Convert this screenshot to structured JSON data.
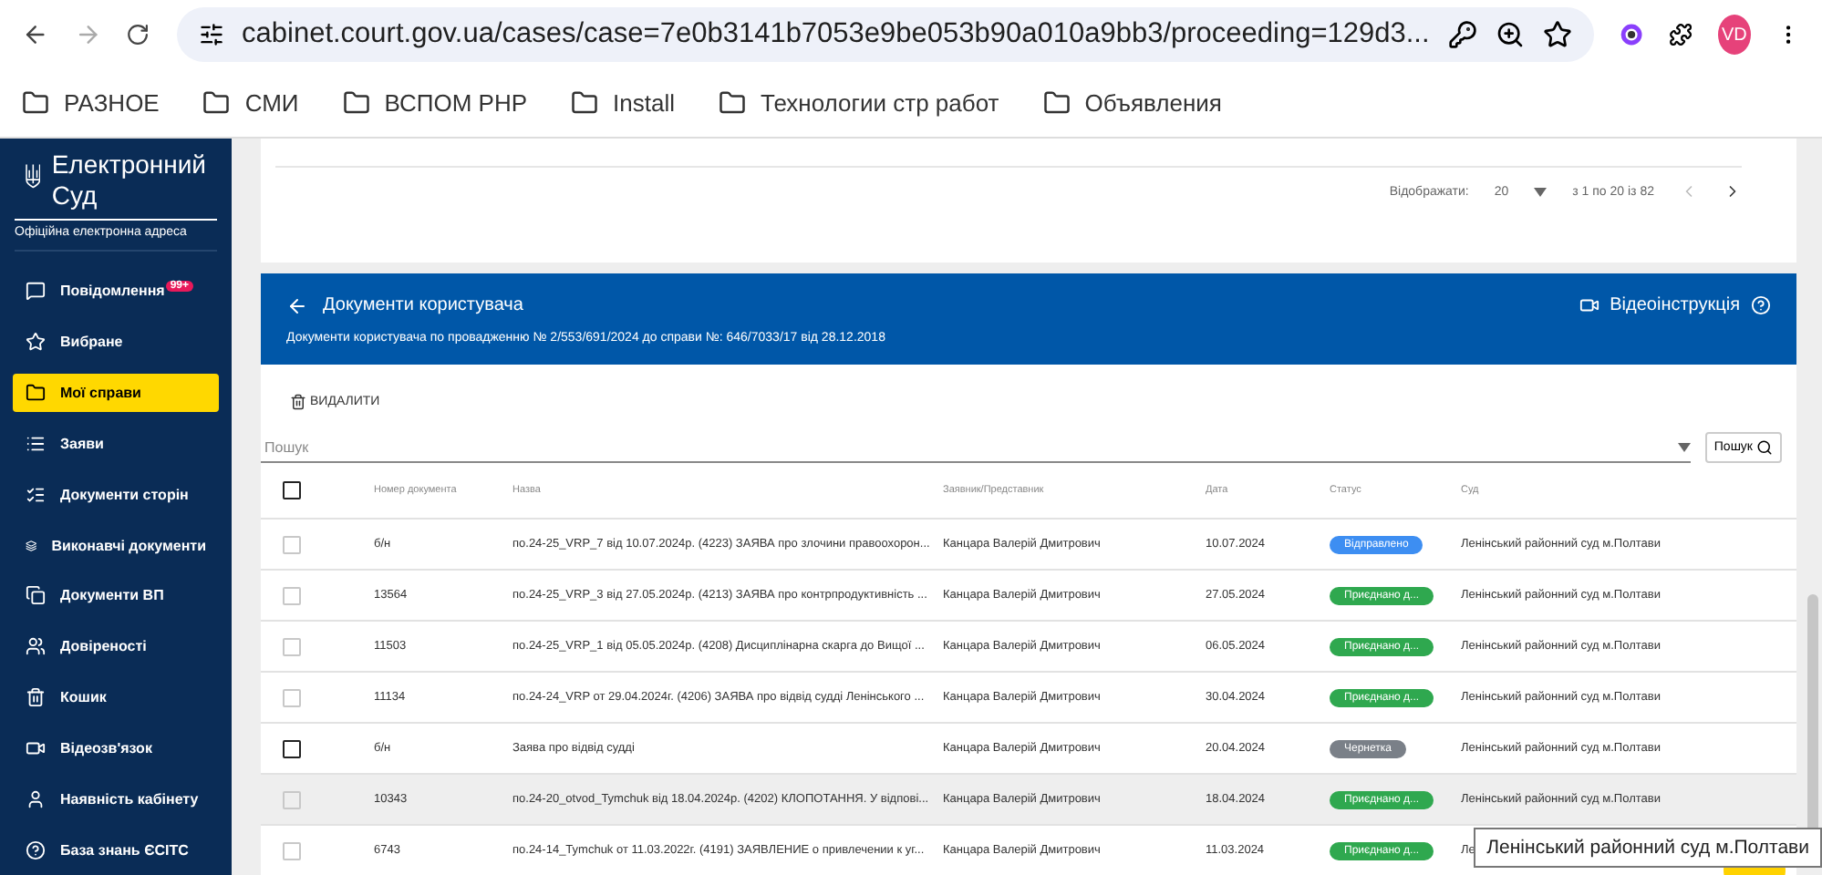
{
  "browser": {
    "url": "cabinet.court.gov.ua/cases/case=7e0b3141b7053e9be053b90a010a9bb3/proceeding=129d3...",
    "profile": "VD",
    "bookmarks": [
      "РАЗНОЕ",
      "СМИ",
      "ВСПОМ PHP",
      "Install",
      "Технологии стр работ",
      "Объявления"
    ]
  },
  "sidebar": {
    "logo_line_1": "Електронний",
    "logo_line_2": "Суд",
    "subtitle": "Офіційна електронна адреса",
    "items": [
      {
        "label": "Повідомлення",
        "badge": "99+",
        "selected": false
      },
      {
        "label": "Вибране",
        "selected": false
      },
      {
        "label": "Мої справи",
        "selected": true
      },
      {
        "label": "Заяви",
        "selected": false
      },
      {
        "label": "Документи сторін",
        "selected": false
      },
      {
        "label": "Виконавчі документи",
        "selected": false
      },
      {
        "label": "Документи ВП",
        "selected": false
      },
      {
        "label": "Довіреності",
        "selected": false
      },
      {
        "label": "Кошик",
        "selected": false
      },
      {
        "label": "Відеозв'язок",
        "selected": false
      },
      {
        "label": "Наявність кабінету",
        "selected": false
      },
      {
        "label": "База знань ЄСІТС",
        "selected": false
      }
    ]
  },
  "pager": {
    "label": "Відображати:",
    "page_size": "20",
    "range": "з 1 по 20 із 82"
  },
  "documents": {
    "title": "Документи користувача",
    "subtitle": "Документи користувача по провадженню № 2/553/691/2024 до справи №: 646/7033/17 від 28.12.2018",
    "video_link": "Відеоінструкція",
    "delete_button": "ВИДАЛИТИ",
    "search_placeholder": "Пошук",
    "search_button": "Пошук",
    "select_all": {
      "checked": false
    },
    "columns": [
      "Номер документа",
      "Назва",
      "Заявник/Представник",
      "Дата",
      "Статус",
      "Суд"
    ],
    "rows": [
      {
        "number": "б/н",
        "name": "по.24-25_VRP_7 від 10.07.2024р. (4223) ЗАЯВА про злочини правоохорон...",
        "applicant": "Канцара Валерій Дмитрович",
        "date": "10.07.2024",
        "status": "Відправлено",
        "color": "#3d8ef2",
        "court": "Ленінський районний суд м.Полтави",
        "disabled": true,
        "highlighted": false
      },
      {
        "number": "13564",
        "name": "по.24-25_VRP_3 від 27.05.2024р. (4213) ЗАЯВА про контрпродуктивність ...",
        "applicant": "Канцара Валерій Дмитрович",
        "date": "27.05.2024",
        "status": "Приєднано д...",
        "color": "#2fa84f",
        "court": "Ленінський районний суд м.Полтави",
        "disabled": true,
        "highlighted": false
      },
      {
        "number": "11503",
        "name": "по.24-25_VRP_1 від 05.05.2024р. (4208) Дисциплінарна скарга до Вищої ...",
        "applicant": "Канцара Валерій Дмитрович",
        "date": "06.05.2024",
        "status": "Приєднано д...",
        "color": "#2fa84f",
        "court": "Ленінський районний суд м.Полтави",
        "disabled": true,
        "highlighted": false
      },
      {
        "number": "11134",
        "name": "по.24-24_VRP от 29.04.2024г. (4206) ЗАЯВА про відвід судді Ленінського ...",
        "applicant": "Канцара Валерій Дмитрович",
        "date": "30.04.2024",
        "status": "Приєднано д...",
        "color": "#2fa84f",
        "court": "Ленінський районний суд м.Полтави",
        "disabled": true,
        "highlighted": false
      },
      {
        "number": "б/н",
        "name": "Заява про відвід судді",
        "applicant": "Канцара Валерій Дмитрович",
        "date": "20.04.2024",
        "status": "Чернетка",
        "color": "#7a8088",
        "court": "Ленінський районний суд м.Полтави",
        "disabled": false,
        "highlighted": false
      },
      {
        "number": "10343",
        "name": "по.24-20_otvod_Tymchuk від 18.04.2024р. (4202) КЛОПОТАННЯ. У відпові...",
        "applicant": "Канцара Валерій Дмитрович",
        "date": "18.04.2024",
        "status": "Приєднано д...",
        "color": "#2fa84f",
        "court": "Ленінський районний суд м.Полтави",
        "disabled": true,
        "highlighted": true
      },
      {
        "number": "6743",
        "name": "по.24-14_Tymchuk от 11.03.2022г. (4191) ЗАЯВЛЕНИЕ о привлечении к уг...",
        "applicant": "Канцара Валерій Дмитрович",
        "date": "11.03.2024",
        "status": "Приєднано д...",
        "color": "#2fa84f",
        "court": "Ле",
        "disabled": true,
        "highlighted": false
      }
    ]
  },
  "tooltip": "Ленінський районний суд м.Полтави"
}
